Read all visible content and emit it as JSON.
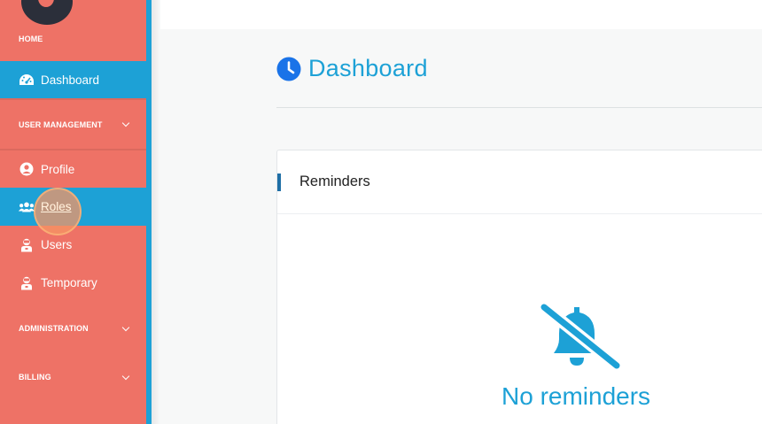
{
  "sidebar": {
    "sections": {
      "home": "HOME",
      "user_management": "USER MANAGEMENT",
      "administration": "ADMINISTRATION",
      "billing": "BILLING"
    },
    "items": {
      "dashboard": "Dashboard",
      "profile": "Profile",
      "roles": "Roles",
      "users": "Users",
      "temporary": "Temporary"
    }
  },
  "main": {
    "title": "Dashboard",
    "reminders_card": {
      "title": "Reminders",
      "empty_text": "No reminders"
    }
  },
  "colors": {
    "sidebar_bg": "#ee7266",
    "accent": "#1da1d6",
    "card_bar": "#1f6fa6"
  },
  "icons": [
    "tachometer-icon",
    "chevron-down-icon",
    "user-circle-icon",
    "users-icon",
    "user-icon",
    "clock-icon",
    "bell-slash-icon"
  ]
}
